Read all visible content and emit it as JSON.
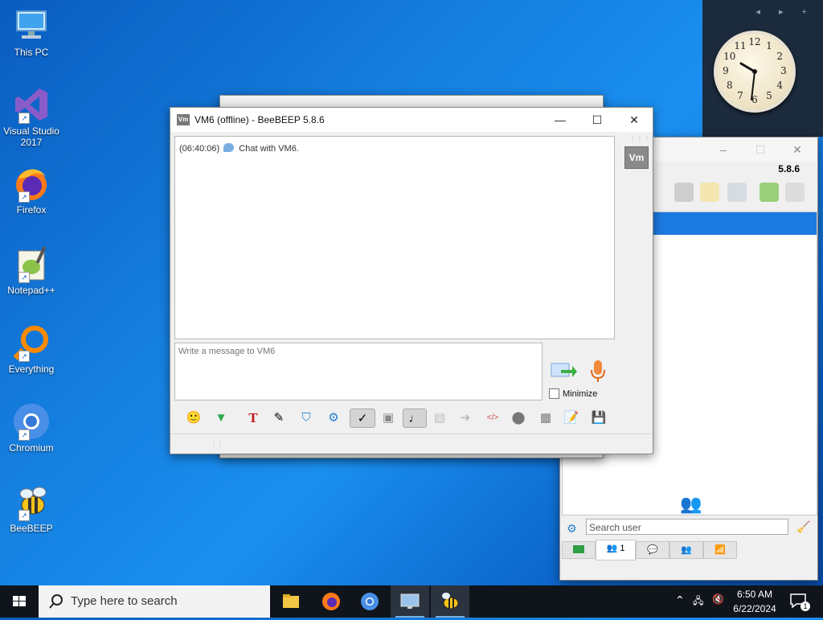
{
  "desktop": {
    "icons": [
      {
        "label": "This PC"
      },
      {
        "label": "Visual Studio\n2017"
      },
      {
        "label": "Firefox"
      },
      {
        "label": "Notepad++"
      },
      {
        "label": "Everything"
      },
      {
        "label": "Chromium"
      },
      {
        "label": "BeeBEEP"
      }
    ]
  },
  "gadget": {
    "nav": "◂ ▸ +",
    "clock_numbers": [
      "12",
      "1",
      "2",
      "3",
      "4",
      "5",
      "6",
      "7",
      "8",
      "9",
      "10",
      "11"
    ]
  },
  "roster_window": {
    "title_buttons": {
      "minimize": "–",
      "maximize": "☐",
      "close": "✕"
    },
    "version": "5.8.6",
    "search_placeholder": "Search user",
    "tabs": [
      {
        "label": ""
      },
      {
        "label": "1"
      },
      {
        "label": ""
      },
      {
        "label": ""
      },
      {
        "label": ""
      }
    ]
  },
  "chat_window": {
    "title": "VM6 (offline) - BeeBEEP 5.8.6",
    "app_icon": "Vm",
    "title_buttons": {
      "minimize": "—",
      "maximize": "☐",
      "close": "✕"
    },
    "message": {
      "time": "(06:40:06)",
      "text": "Chat with VM6."
    },
    "avatar": "Vm",
    "input_placeholder": "Write a message to VM6",
    "minimize_label": "Minimize"
  },
  "taskbar": {
    "search_text": "Type here to search",
    "time": "6:50 AM",
    "date": "6/22/2024",
    "notification_count": "1"
  },
  "colors": {
    "accent": "#1c7ae0",
    "taskbar": "#10151c"
  }
}
